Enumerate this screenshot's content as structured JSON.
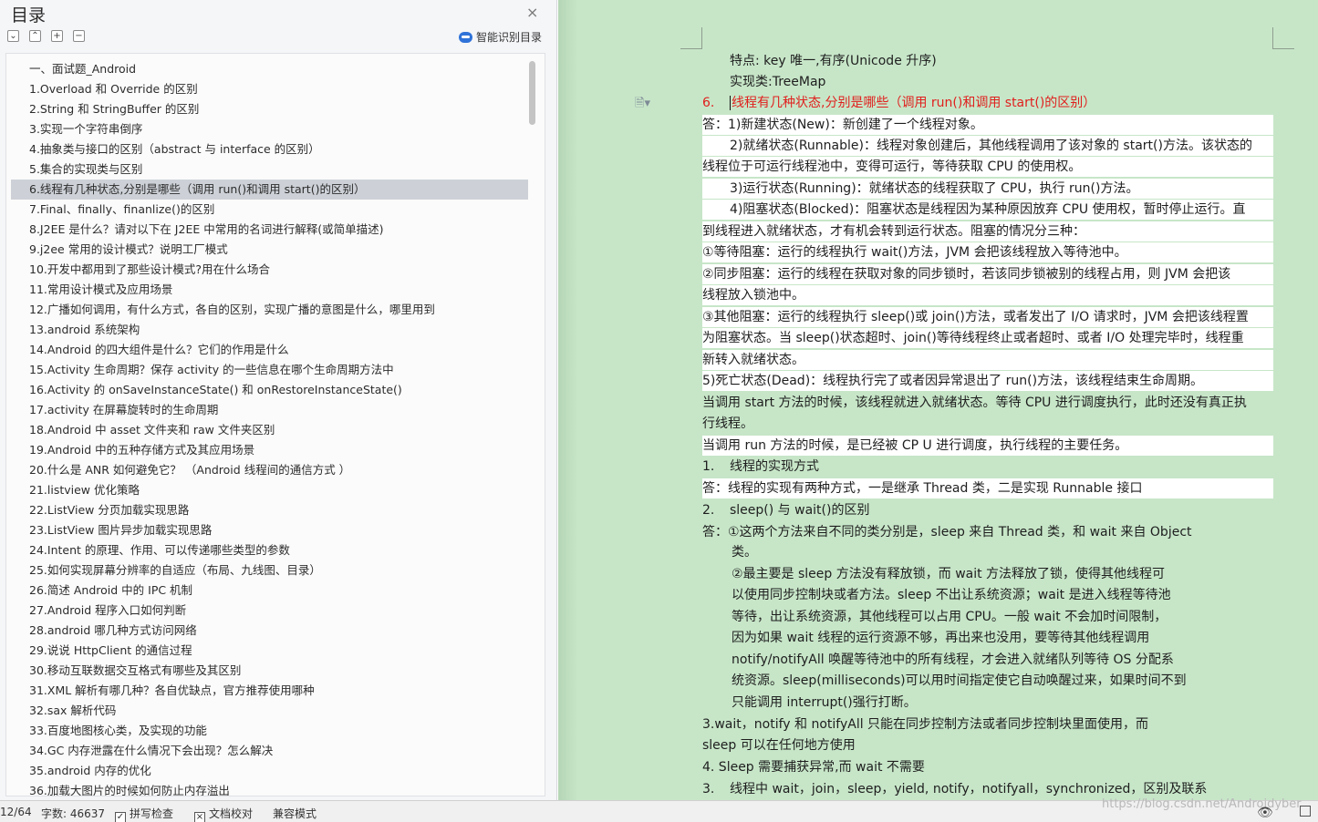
{
  "toc": {
    "title": "目录",
    "close_glyph": "×",
    "smart_toc_label": "智能识别目录",
    "tool_glyphs": [
      "⌄",
      "⌃",
      "+",
      "−"
    ],
    "items": [
      "一、面试题_Android",
      "1.Overload 和 Override 的区别",
      "2.String 和 StringBuffer 的区别",
      "3.实现一个字符串倒序",
      "4.抽象类与接口的区别（abstract 与 interface 的区别）",
      "5.集合的实现类与区别",
      "6.线程有几种状态,分别是哪些（调用 run()和调用 start()的区别）",
      "7.Final、finally、finanlize()的区别",
      "8.J2EE 是什么？请对以下在 J2EE 中常用的名词进行解释(或简单描述)",
      "9.j2ee 常用的设计模式？说明工厂模式",
      "10.开发中都用到了那些设计模式?用在什么场合",
      "11.常用设计模式及应用场景",
      "12.广播如何调用，有什么方式，各自的区别，实现广播的意图是什么，哪里用到",
      "13.android 系统架构",
      "14.Android 的四大组件是什么？它们的作用是什么",
      "15.Activity 生命周期？保存 activity 的一些信息在哪个生命周期方法中",
      "16.Activity 的 onSaveInstanceState() 和 onRestoreInstanceState()",
      "17.activity 在屏幕旋转时的生命周期",
      "18.Android 中 asset 文件夹和 raw 文件夹区别",
      "19.Android 中的五种存储方式及其应用场景",
      "20.什么是 ANR 如何避免它？ （Android 线程间的通信方式 ）",
      "21.listview 优化策略",
      "22.ListView 分页加载实现思路",
      "23.ListView 图片异步加载实现思路",
      "24.Intent 的原理、作用、可以传递哪些类型的参数",
      "25.如何实现屏幕分辨率的自适应（布局、九线图、目录）",
      "26.简述 Android 中的 IPC 机制",
      "27.Android 程序入口如何判断",
      "28.android 哪几种方式访问网络",
      "29.说说 HttpClient 的通信过程",
      "30.移动互联数据交互格式有哪些及其区别",
      "31.XML 解析有哪几种？各自优缺点，官方推荐使用哪种",
      "32.sax 解析代码",
      "33.百度地图核心类，及实现的功能",
      "34.GC 内存泄露在什么情况下会出现？怎么解决",
      "35.android 内存的优化",
      "36.加载大图片的时候如何防止内存溢出"
    ]
  },
  "doc": {
    "para_icon": "🗎▾",
    "lines": [
      {
        "t": "特点: key 唯一,有序(Unicode 升序)"
      },
      {
        "t": "实现类:TreeMap"
      },
      {
        "n": "6.",
        "t": "线程有几种状态,分别是哪些（调用 run()和调用 start()的区别）"
      },
      {
        "t": "答：1)新建状态(New)：新创建了一个线程对象。"
      },
      {
        "t": "2)就绪状态(Runnable)：线程对象创建后，其他线程调用了该对象的 start()方法。该状态的"
      },
      {
        "t": "线程位于可运行线程池中，变得可运行，等待获取 CPU 的使用权。"
      },
      {
        "t": "3)运行状态(Running)：就绪状态的线程获取了 CPU，执行 run()方法。"
      },
      {
        "t": "4)阻塞状态(Blocked)：阻塞状态是线程因为某种原因放弃 CPU 使用权，暂时停止运行。直"
      },
      {
        "t": "到线程进入就绪状态，才有机会转到运行状态。阻塞的情况分三种："
      },
      {
        "t": "①等待阻塞：运行的线程执行 wait()方法，JVM 会把该线程放入等待池中。"
      },
      {
        "t": "②同步阻塞：运行的线程在获取对象的同步锁时，若该同步锁被别的线程占用，则 JVM 会把该"
      },
      {
        "t": "线程放入锁池中。"
      },
      {
        "t": "③其他阻塞：运行的线程执行 sleep()或 join()方法，或者发出了 I/O 请求时，JVM 会把该线程置"
      },
      {
        "t": "为阻塞状态。当 sleep()状态超时、join()等待线程终止或者超时、或者 I/O 处理完毕时，线程重"
      },
      {
        "t": "新转入就绪状态。"
      },
      {
        "t": "5)死亡状态(Dead)：线程执行完了或者因异常退出了 run()方法，该线程结束生命周期。"
      },
      {
        "t": "当调用 start 方法的时候，该线程就进入就绪状态。等待 CPU 进行调度执行，此时还没有真正执"
      },
      {
        "t": "行线程。"
      },
      {
        "t": "当调用 run 方法的时候，是已经被 CP U 进行调度，执行线程的主要任务。"
      },
      {
        "n": "1.",
        "t": "线程的实现方式"
      },
      {
        "t": "答：线程的实现有两种方式，一是继承 Thread 类，二是实现 Runnable 接口"
      },
      {
        "n": "2.",
        "t": "sleep() 与 wait()的区别"
      },
      {
        "t": "答：①这两个方法来自不同的类分别是，sleep 来自 Thread 类，和 wait 来自 Object"
      },
      {
        "t": "类。"
      },
      {
        "t": "②最主要是 sleep 方法没有释放锁，而 wait 方法释放了锁，使得其他线程可"
      },
      {
        "t": "以使用同步控制块或者方法。sleep 不出让系统资源；wait 是进入线程等待池"
      },
      {
        "t": "等待，出让系统资源，其他线程可以占用 CPU。一般 wait 不会加时间限制，"
      },
      {
        "t": "因为如果 wait 线程的运行资源不够，再出来也没用，要等待其他线程调用"
      },
      {
        "t": "notify/notifyAll 唤醒等待池中的所有线程，才会进入就绪队列等待 OS 分配系"
      },
      {
        "t": "统资源。sleep(milliseconds)可以用时间指定使它自动唤醒过来，如果时间不到"
      },
      {
        "t": "只能调用 interrupt()强行打断。"
      },
      {
        "t": "3.wait，notify 和 notifyAll 只能在同步控制方法或者同步控制块里面使用，而"
      },
      {
        "t": "sleep 可以在任何地方使用"
      },
      {
        "t": "4. Sleep 需要捕获异常,而 wait 不需要"
      },
      {
        "n": "3.",
        "t": "线程中 wait，join，sleep，yield, notify，notifyall，synchronized，区别及联系"
      }
    ]
  },
  "status": {
    "page": "12/64",
    "word_count": "字数: 46637",
    "spellcheck": "拼写检查",
    "doc_proof": "文档校对",
    "compat_mode": "兼容模式",
    "watermark": "https://blog.csdn.net/Androidyber"
  }
}
